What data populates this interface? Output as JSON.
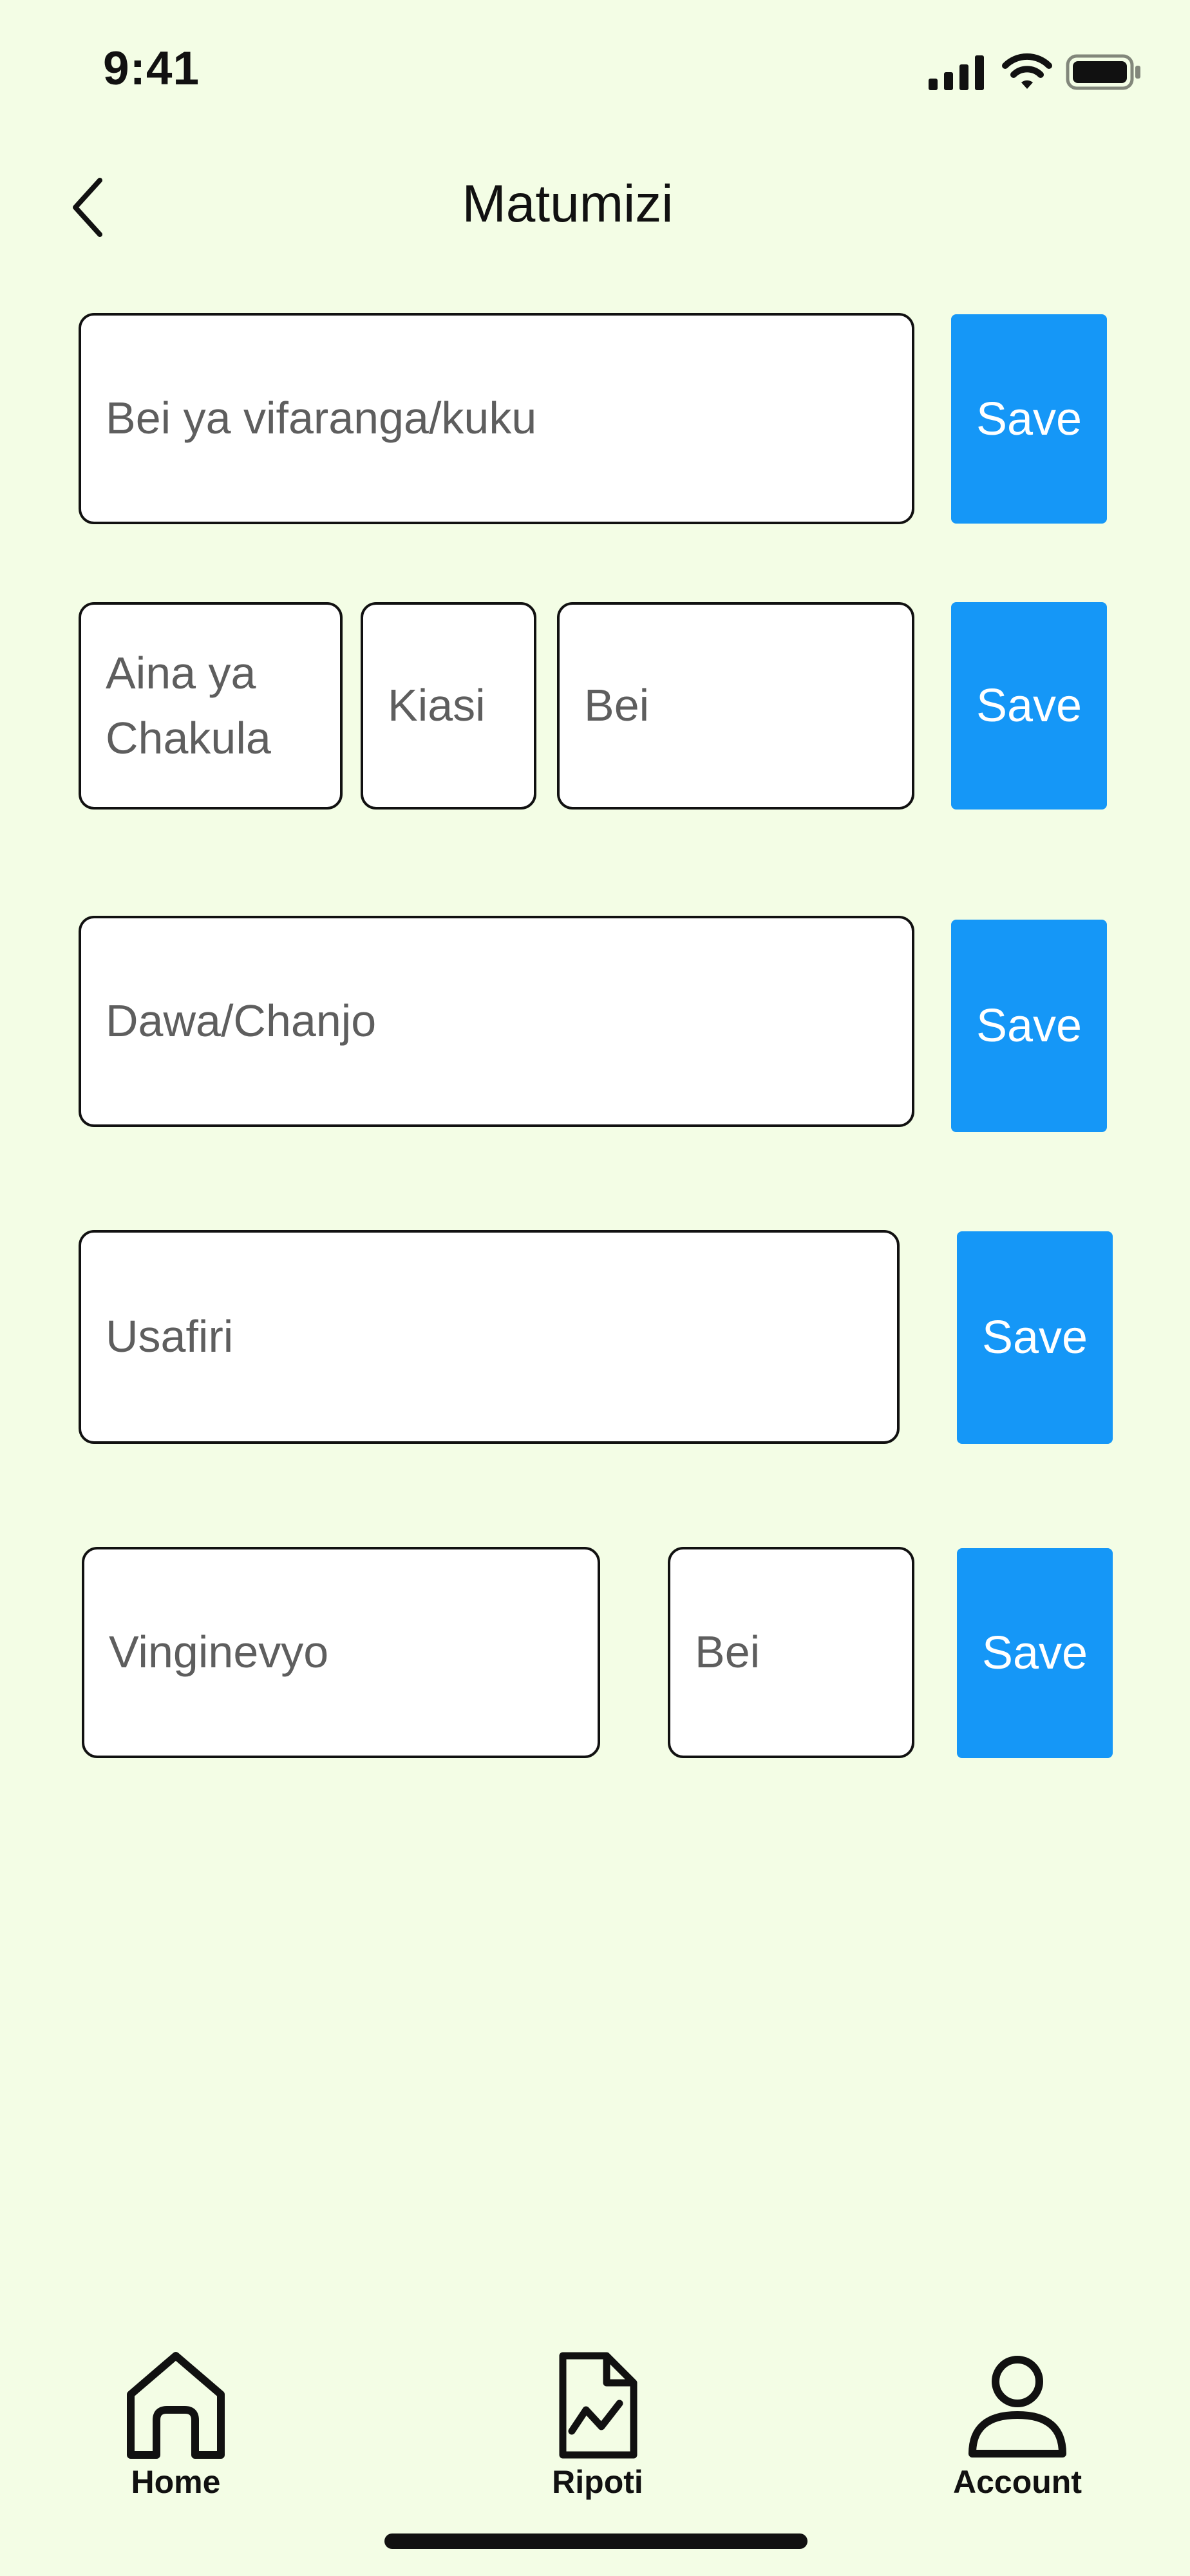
{
  "status_bar": {
    "time": "9:41"
  },
  "header": {
    "title": "Matumizi"
  },
  "rows": [
    {
      "fields": [
        {
          "placeholder": "Bei ya vifaranga/kuku"
        }
      ],
      "save_label": "Save"
    },
    {
      "fields": [
        {
          "placeholder": "Aina ya Chakula"
        },
        {
          "placeholder": "Kiasi"
        },
        {
          "placeholder": "Bei"
        }
      ],
      "save_label": "Save"
    },
    {
      "fields": [
        {
          "placeholder": "Dawa/Chanjo"
        }
      ],
      "save_label": "Save"
    },
    {
      "fields": [
        {
          "placeholder": "Usafiri"
        }
      ],
      "save_label": "Save"
    },
    {
      "fields": [
        {
          "placeholder": "Vinginevyo"
        },
        {
          "placeholder": "Bei"
        }
      ],
      "save_label": "Save"
    }
  ],
  "bottom_nav": {
    "items": [
      {
        "label": "Home",
        "icon": "home-icon"
      },
      {
        "label": "Ripoti",
        "icon": "report-icon"
      },
      {
        "label": "Account",
        "icon": "account-icon"
      }
    ]
  },
  "colors": {
    "background": "#f3fde5",
    "accent": "#1597f7"
  }
}
